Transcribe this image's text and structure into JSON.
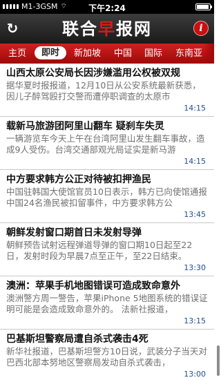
{
  "status": {
    "carrier": "M1-3GSM",
    "time": "下午2:24"
  },
  "header": {
    "logo_left": "联合",
    "logo_mid": "早",
    "logo_right": "报网"
  },
  "tabs": [
    "主页",
    "即时",
    "新加坡",
    "中国",
    "国际",
    "东南亚"
  ],
  "active_tab": "即时",
  "news": [
    {
      "title": "山西太原公安局长因涉嫌滥用公权被双规",
      "summary": "据华夏时报报道，12月10日从公安系统最新获悉，因儿子醉驾殴打交警而遭停职调查的太原市",
      "time": "14:15"
    },
    {
      "title": "载新马旅游团阿里山翻车 疑刹车失灵",
      "summary": "一辆游览车今天上午在台湾阿里山发生翻车事故，造成9人受伤。台湾交通部观光局证实是新马游",
      "time": "14:15"
    },
    {
      "title": "中方要求韩方公正对待被扣押渔民",
      "summary": "中国驻韩国大使馆官员10日表示，韩方已向使馆通报中国24名渔民被扣留事件，中方要求韩方公",
      "time": "13:45"
    },
    {
      "title": "朝鲜发射窗口期首日未发射导弹",
      "summary": "朝鲜预告试射远程弹道导弹的窗口期10日起至22日，发射时段为早晨7点至正午，至22日结束。",
      "time": "13:30"
    },
    {
      "title": "澳洲：苹果手机地图错误可造成致命意外",
      "summary": "澳洲警方周一警告，苹果iPhone 5地图系统的错误证明可能是会造成致命意外的。            法新社报道，",
      "time": "13:15"
    },
    {
      "title": "巴基斯坦警察局遭自杀式袭击4死",
      "summary": "新华社报道，巴基斯坦警方10日说，武装分子当天对巴西北部本努地区警察局发动自杀式袭击，",
      "time": "13:00"
    }
  ]
}
